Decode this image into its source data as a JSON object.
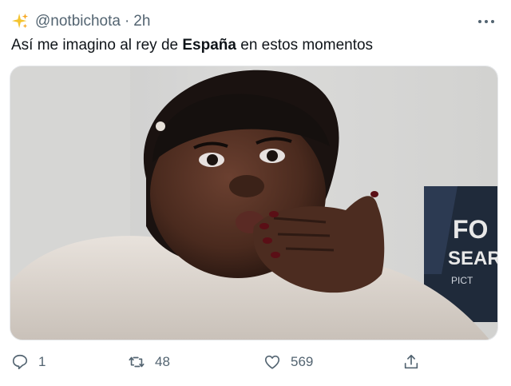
{
  "tweet": {
    "handle": "@notbichota",
    "separator": "·",
    "time": "2h",
    "text_before": "Así me imagino al rey de ",
    "text_bold": "España",
    "text_after": " en estos momentos",
    "media": {
      "sign_lines": [
        "FO",
        "SEAR",
        "PICT"
      ]
    }
  },
  "actions": {
    "reply_count": "1",
    "retweet_count": "48",
    "like_count": "569"
  },
  "colors": {
    "text_primary": "#0f1419",
    "text_secondary": "#536471",
    "sparkle": "#f4c430"
  },
  "icons": [
    "sparkle-icon",
    "more-icon",
    "reply-icon",
    "retweet-icon",
    "like-icon",
    "share-icon"
  ]
}
